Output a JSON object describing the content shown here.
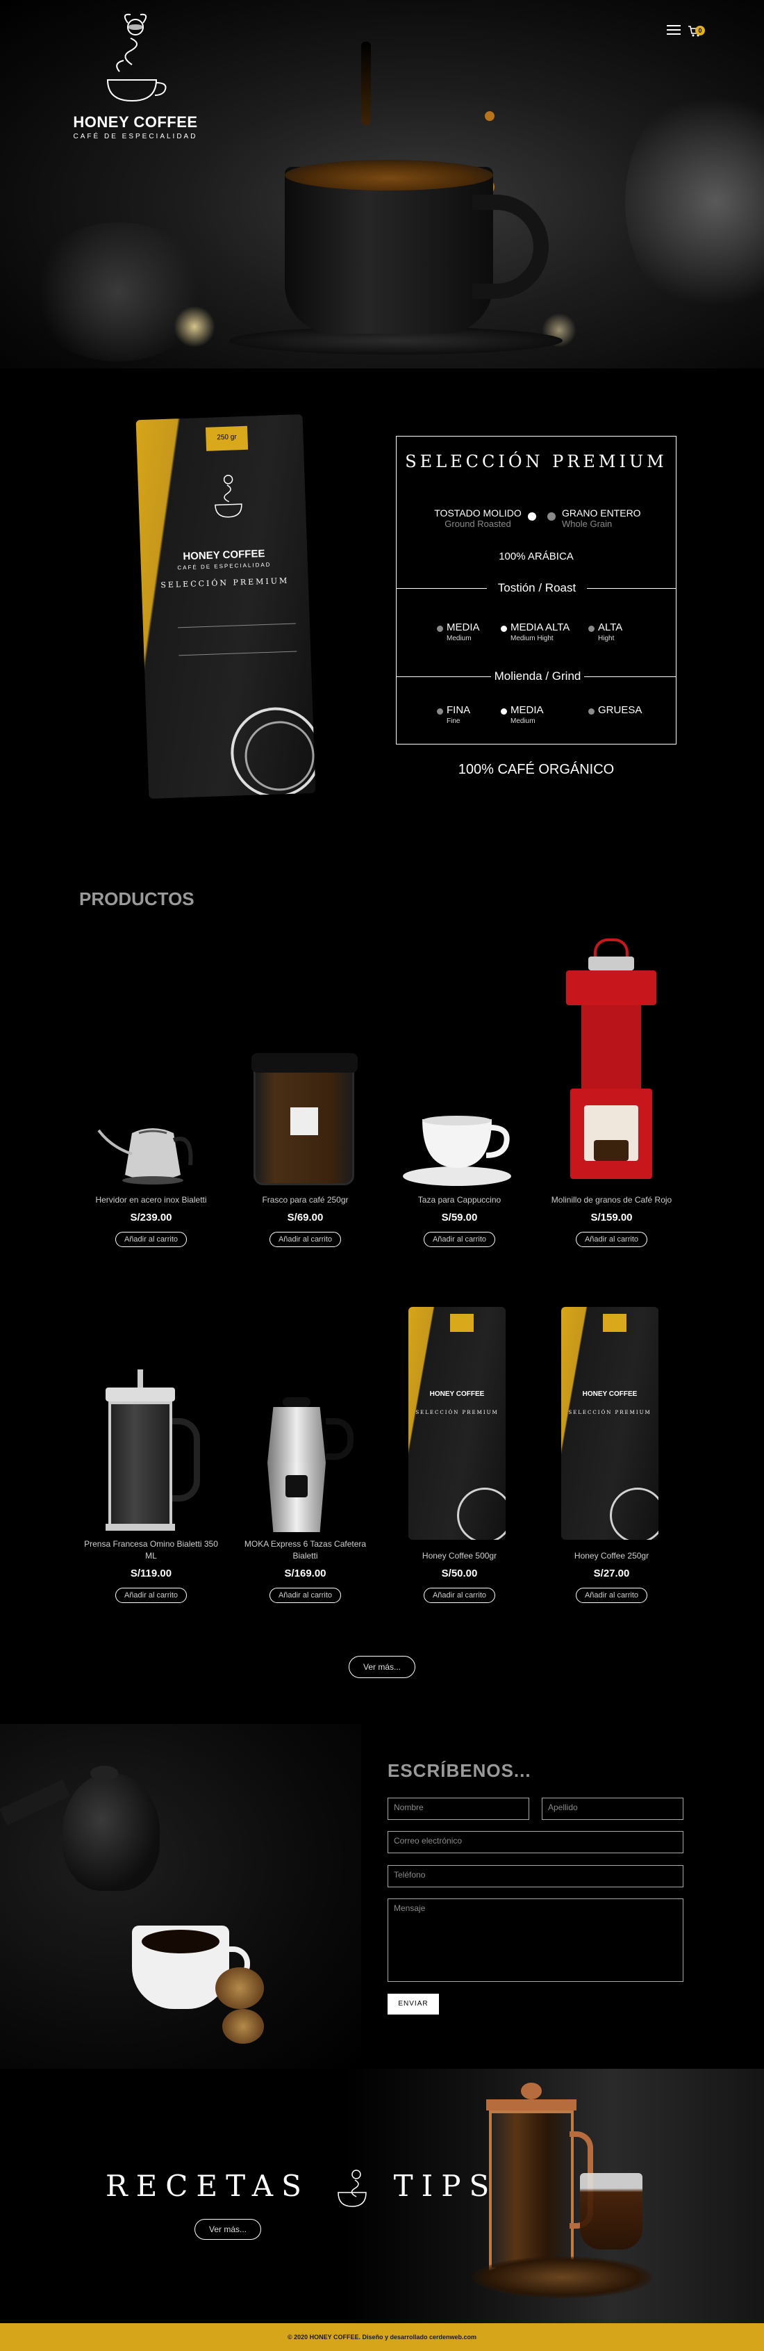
{
  "brand": {
    "name": "HONEY COFFEE",
    "tagline": "CAFÉ DE ESPECIALIDAD"
  },
  "header": {
    "menu_icon": "hamburger-icon",
    "cart_icon": "cart-icon",
    "cart_count": "0"
  },
  "premium": {
    "title": "SELECCIÓN PREMIUM",
    "bag_brand": "HONEY COFFEE",
    "bag_sub": "CAFÉ DE ESPECIALIDAD",
    "bag_title": "SELECCIÓN PREMIUM",
    "bag_tag": "250 gr",
    "option_left": {
      "label": "TOSTADO MOLIDO",
      "sub": "Ground Roasted"
    },
    "option_right": {
      "label": "GRANO ENTERO",
      "sub": "Whole Grain"
    },
    "arabica": "100% ARÁBICA",
    "roast_title": "Tostión / Roast",
    "roast": [
      {
        "label": "MEDIA",
        "sub": "Medium"
      },
      {
        "label": "MEDIA ALTA",
        "sub": "Medium Hight"
      },
      {
        "label": "ALTA",
        "sub": "Hight"
      }
    ],
    "grind_title": "Molienda / Grind",
    "grind": [
      {
        "label": "FINA",
        "sub": "Fine"
      },
      {
        "label": "MEDIA",
        "sub": "Medium"
      },
      {
        "label": "GRUESA",
        "sub": ""
      }
    ],
    "organic": "100% CAFÉ ORGÁNICO"
  },
  "products": {
    "title": "PRODUCTOS",
    "add_label": "Añadir al carrito",
    "items": [
      {
        "name": "Hervidor en acero inox Bialetti",
        "price": "S/239.00"
      },
      {
        "name": "Frasco para café 250gr",
        "price": "S/69.00"
      },
      {
        "name": "Taza para Cappuccino",
        "price": "S/59.00"
      },
      {
        "name": "Molinillo de granos de Café Rojo",
        "price": "S/159.00"
      },
      {
        "name": "Prensa Francesa Omino Bialetti 350 ML",
        "price": "S/119.00"
      },
      {
        "name": "MOKA Express 6 Tazas Cafetera Bialetti",
        "price": "S/169.00"
      },
      {
        "name": "Honey Coffee 500gr",
        "price": "S/50.00"
      },
      {
        "name": "Honey Coffee 250gr",
        "price": "S/27.00"
      }
    ],
    "more_label": "Ver más..."
  },
  "contact": {
    "title": "ESCRÍBENOS...",
    "name_placeholder": "Nombre",
    "lastname_placeholder": "Apellido",
    "email_placeholder": "Correo electrónico",
    "phone_placeholder": "Teléfono",
    "message_placeholder": "Mensaje",
    "send_label": "ENVIAR"
  },
  "recetas": {
    "left": "RECETAS",
    "right": "TIPS",
    "more_label": "Ver más..."
  },
  "footer": {
    "text": "© 2020 HONEY COFFEE. Diseño y desarrollado cerdenweb.com"
  },
  "colors": {
    "accent": "#d6a51a",
    "background": "#000000",
    "grinder": "#c8161d"
  }
}
